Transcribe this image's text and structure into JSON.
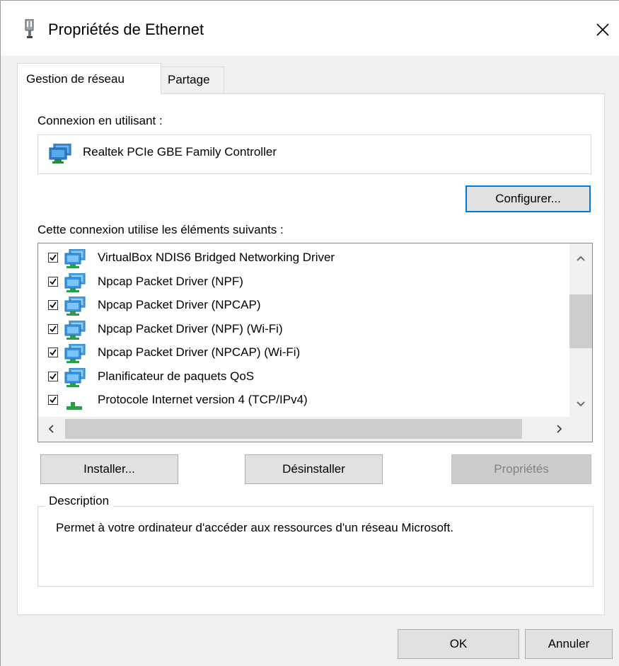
{
  "window": {
    "title": "Propriétés de Ethernet"
  },
  "tabs": [
    {
      "label": "Gestion de réseau",
      "active": true
    },
    {
      "label": "Partage",
      "active": false
    }
  ],
  "connection": {
    "label": "Connexion en utilisant :",
    "adapter": "Realtek PCIe GBE Family Controller",
    "configure_button": "Configurer..."
  },
  "components": {
    "label": "Cette connexion utilise les éléments suivants :",
    "items": [
      {
        "label": "VirtualBox NDIS6 Bridged Networking Driver",
        "checked": true,
        "icon": "network-service-icon"
      },
      {
        "label": "Npcap Packet Driver (NPF)",
        "checked": true,
        "icon": "network-service-icon"
      },
      {
        "label": "Npcap Packet Driver (NPCAP)",
        "checked": true,
        "icon": "network-service-icon"
      },
      {
        "label": "Npcap Packet Driver (NPF) (Wi-Fi)",
        "checked": true,
        "icon": "network-service-icon"
      },
      {
        "label": "Npcap Packet Driver (NPCAP) (Wi-Fi)",
        "checked": true,
        "icon": "network-service-icon"
      },
      {
        "label": "Planificateur de paquets QoS",
        "checked": true,
        "icon": "network-service-icon"
      },
      {
        "label": "Protocole Internet version 4 (TCP/IPv4)",
        "checked": true,
        "icon": "network-protocol-icon"
      }
    ]
  },
  "buttons": {
    "install": "Installer...",
    "uninstall": "Désinstaller",
    "properties": "Propriétés",
    "ok": "OK",
    "cancel": "Annuler"
  },
  "description": {
    "title": "Description",
    "text": "Permet à votre ordinateur d'accéder aux ressources d'un réseau Microsoft."
  },
  "colors": {
    "accent": "#0078d7",
    "dialog_bg": "#f0f0f0",
    "panel_bg": "#ffffff"
  }
}
